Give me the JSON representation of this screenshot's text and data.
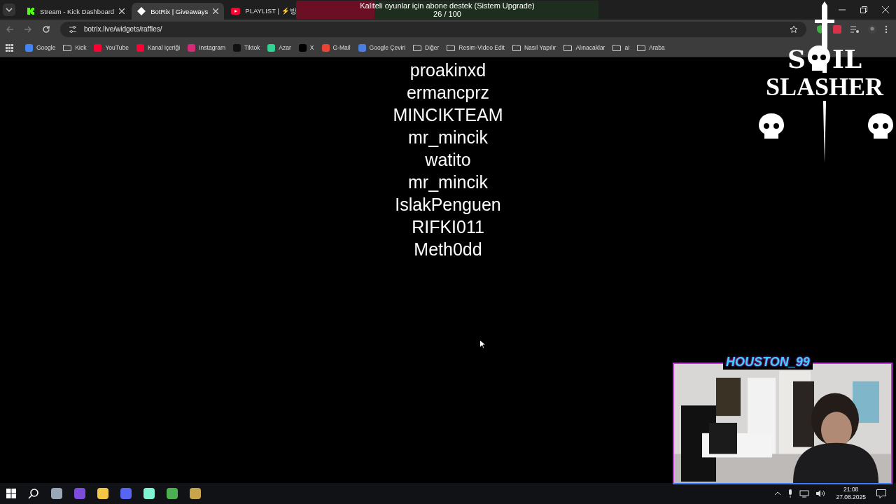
{
  "tabs": [
    {
      "title": "Stream - Kick Dashboard",
      "kind": "kick",
      "selected": false
    },
    {
      "title": "BotRix | Giveaways",
      "kind": "botrix",
      "selected": true
    },
    {
      "title": "PLAYLIST | ⚡방",
      "kind": "youtube",
      "selected": false
    }
  ],
  "address": "botrix.live/widgets/raffles/",
  "bookmarks": [
    {
      "label": "Google",
      "kind": "google"
    },
    {
      "label": "Kick",
      "kind": "folder"
    },
    {
      "label": "YouTube",
      "kind": "youtube"
    },
    {
      "label": "Kanal içeriği",
      "kind": "youtube"
    },
    {
      "label": "Instagram",
      "kind": "instagram"
    },
    {
      "label": "Tiktok",
      "kind": "tiktok"
    },
    {
      "label": "Azar",
      "kind": "azar"
    },
    {
      "label": "X",
      "kind": "x"
    },
    {
      "label": "G-Mail",
      "kind": "gmail"
    },
    {
      "label": "Google Çeviri",
      "kind": "translate"
    },
    {
      "label": "Diğer",
      "kind": "folder"
    },
    {
      "label": "Resim-Video Edit",
      "kind": "folder"
    },
    {
      "label": "Nasıl Yapılır",
      "kind": "folder"
    },
    {
      "label": "Alınacaklar",
      "kind": "folder"
    },
    {
      "label": "ai",
      "kind": "folder"
    },
    {
      "label": "Araba",
      "kind": "folder"
    }
  ],
  "winners": [
    "proakinxd",
    "ermancprz",
    "MINCIKTEAM",
    "mr_mincik",
    "watito",
    "mr_mincik",
    "IslakPenguen",
    "RIFKI011",
    "Meth0dd"
  ],
  "goal": {
    "title": "Kaliteli oyunlar için abone destek (Sistem Upgrade)",
    "count": "26 / 100",
    "level": 0.26
  },
  "logo": {
    "line1_start": "S",
    "line1_end": "IL",
    "line2": "SLASHER"
  },
  "webcam": {
    "name": "HOUSTON_99"
  },
  "taskbar": {
    "apps": [
      {
        "kind": "search"
      },
      {
        "kind": "pc"
      },
      {
        "kind": "clapper"
      },
      {
        "kind": "files"
      },
      {
        "kind": "discord"
      },
      {
        "kind": "streamlabs"
      },
      {
        "kind": "chrome"
      },
      {
        "kind": "league"
      }
    ],
    "time": "21:08",
    "date": "27.08.2025"
  }
}
